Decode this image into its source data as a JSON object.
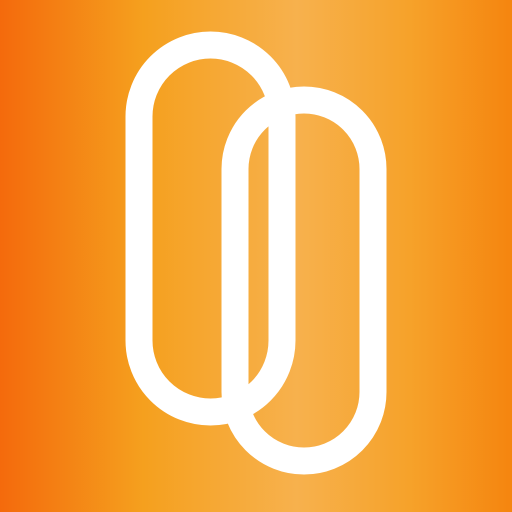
{
  "icon": {
    "name": "two-pill-logo-icon",
    "colors": {
      "gradient_edge_left": "#F46A0C",
      "gradient_mid_left": "#F5A01E",
      "gradient_center": "#F7B14D",
      "gradient_mid_right": "#F6A22A",
      "gradient_edge_right": "#F5850F",
      "stroke": "#FFFFFF"
    }
  }
}
